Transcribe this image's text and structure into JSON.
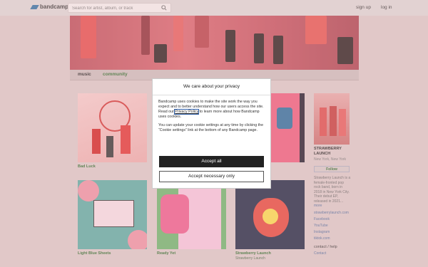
{
  "header": {
    "logo_text": "bandcamp",
    "search_placeholder": "Search for artist, album, or track",
    "signup": "sign up",
    "login": "log in"
  },
  "tabs": {
    "music": "music",
    "community": "community"
  },
  "albums": [
    {
      "title": "Bad Luck",
      "artist": ""
    },
    {
      "title": "Light Blue Sheets",
      "artist": ""
    },
    {
      "title": "Ready Yet",
      "artist": ""
    },
    {
      "title": "Strawberry Launch",
      "artist": "Strawberry Launch"
    }
  ],
  "artist": {
    "name": "STRAWBERRY LAUNCH",
    "location": "New York, New York",
    "follow": "Follow",
    "bio": "Strawberry Launch is a female-fronted pop rock band, born in 2018 in New York City. Their debut EP, released in 2021...",
    "more": "more",
    "links": [
      "strawberrylaunch.com",
      "Facebook",
      "YouTube",
      "Instagram",
      "tiktok.com"
    ],
    "contact_heading": "contact / help",
    "contact": "Contact"
  },
  "cookie_modal": {
    "title": "We care about your privacy",
    "para1_before": "Bandcamp uses cookies to make the site work the way you expect and to better understand how our users access the site. Read our ",
    "privacy_link": "Privacy Policy",
    "para1_after": " to learn more about how Bandcamp uses cookies.",
    "para2": "You can update your cookie settings at any time by clicking the “Cookie settings” link at the bottom of any Bandcamp page.",
    "accept_all": "Accept all",
    "accept_necessary": "Accept necessary only"
  },
  "colors": {
    "accent_green": "#2d6b2d",
    "page_bg": "#d7c4c4"
  }
}
